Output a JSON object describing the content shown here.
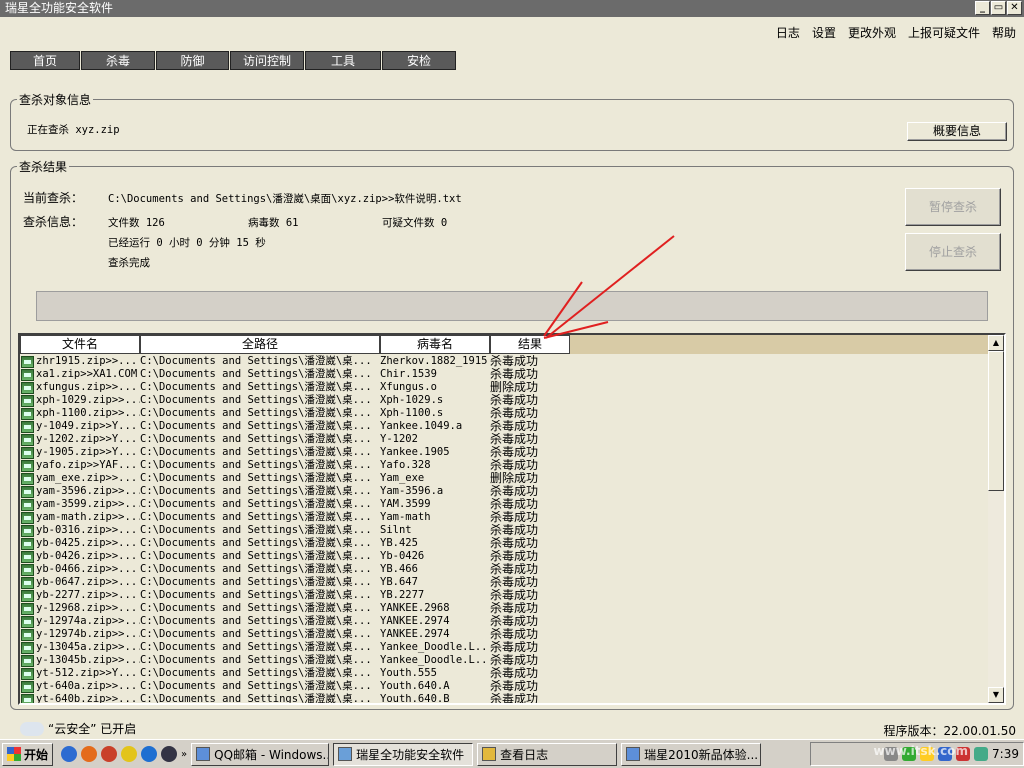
{
  "window": {
    "title": "瑞星全功能安全软件",
    "controls": [
      "_",
      "▭",
      "✕"
    ]
  },
  "top_menu": [
    "日志",
    "设置",
    "更改外观",
    "上报可疑文件",
    "帮助"
  ],
  "tabs": [
    "首页",
    "杀毒",
    "防御",
    "访问控制",
    "工具",
    "安检"
  ],
  "scan_target": {
    "group_title": "查杀对象信息",
    "current_text": "正在查杀 xyz.zip",
    "summary_button": "概要信息"
  },
  "scan_result": {
    "group_title": "查杀结果",
    "current_label": "当前查杀：",
    "current_path": "C:\\Documents and Settings\\潘澄崴\\桌面\\xyz.zip>>软件说明.txt",
    "info_label": "查杀信息：",
    "file_count": "文件数 126",
    "virus_count": "病毒数 61",
    "suspicious_count": "可疑文件数 0",
    "elapsed": "已经运行 0 小时 0 分钟 15  秒",
    "status": "查杀完成",
    "pause_button": "暂停查杀",
    "stop_button": "停止查杀"
  },
  "table": {
    "columns": [
      "文件名",
      "全路径",
      "病毒名",
      "结果"
    ],
    "rows": [
      [
        "zhr1915.zip>>...",
        "C:\\Documents and Settings\\潘澄崴\\桌...",
        "Zherkov.1882_1915",
        "杀毒成功"
      ],
      [
        "xa1.zip>>XA1.COM",
        "C:\\Documents and Settings\\潘澄崴\\桌...",
        "Chir.1539",
        "杀毒成功"
      ],
      [
        "xfungus.zip>>...",
        "C:\\Documents and Settings\\潘澄崴\\桌...",
        "Xfungus.o",
        "删除成功"
      ],
      [
        "xph-1029.zip>>...",
        "C:\\Documents and Settings\\潘澄崴\\桌...",
        "Xph-1029.s",
        "杀毒成功"
      ],
      [
        "xph-1100.zip>>...",
        "C:\\Documents and Settings\\潘澄崴\\桌...",
        "Xph-1100.s",
        "杀毒成功"
      ],
      [
        "y-1049.zip>>Y...",
        "C:\\Documents and Settings\\潘澄崴\\桌...",
        "Yankee.1049.a",
        "杀毒成功"
      ],
      [
        "y-1202.zip>>Y...",
        "C:\\Documents and Settings\\潘澄崴\\桌...",
        "Y-1202",
        "杀毒成功"
      ],
      [
        "y-1905.zip>>Y...",
        "C:\\Documents and Settings\\潘澄崴\\桌...",
        "Yankee.1905",
        "杀毒成功"
      ],
      [
        "yafo.zip>>YAF...",
        "C:\\Documents and Settings\\潘澄崴\\桌...",
        "Yafo.328",
        "杀毒成功"
      ],
      [
        "yam_exe.zip>>...",
        "C:\\Documents and Settings\\潘澄崴\\桌...",
        "Yam_exe",
        "删除成功"
      ],
      [
        "yam-3596.zip>>...",
        "C:\\Documents and Settings\\潘澄崴\\桌...",
        "Yam-3596.a",
        "杀毒成功"
      ],
      [
        "yam-3599.zip>>...",
        "C:\\Documents and Settings\\潘澄崴\\桌...",
        "YAM.3599",
        "杀毒成功"
      ],
      [
        "yam-math.zip>>...",
        "C:\\Documents and Settings\\潘澄崴\\桌...",
        "Yam-math",
        "杀毒成功"
      ],
      [
        "yb-0316.zip>>...",
        "C:\\Documents and Settings\\潘澄崴\\桌...",
        "Silnt",
        "杀毒成功"
      ],
      [
        "yb-0425.zip>>...",
        "C:\\Documents and Settings\\潘澄崴\\桌...",
        "YB.425",
        "杀毒成功"
      ],
      [
        "yb-0426.zip>>...",
        "C:\\Documents and Settings\\潘澄崴\\桌...",
        "Yb-0426",
        "杀毒成功"
      ],
      [
        "yb-0466.zip>>...",
        "C:\\Documents and Settings\\潘澄崴\\桌...",
        "YB.466",
        "杀毒成功"
      ],
      [
        "yb-0647.zip>>...",
        "C:\\Documents and Settings\\潘澄崴\\桌...",
        "YB.647",
        "杀毒成功"
      ],
      [
        "yb-2277.zip>>...",
        "C:\\Documents and Settings\\潘澄崴\\桌...",
        "YB.2277",
        "杀毒成功"
      ],
      [
        "y-12968.zip>>...",
        "C:\\Documents and Settings\\潘澄崴\\桌...",
        "YANKEE.2968",
        "杀毒成功"
      ],
      [
        "y-12974a.zip>>...",
        "C:\\Documents and Settings\\潘澄崴\\桌...",
        "YANKEE.2974",
        "杀毒成功"
      ],
      [
        "y-12974b.zip>>...",
        "C:\\Documents and Settings\\潘澄崴\\桌...",
        "YANKEE.2974",
        "杀毒成功"
      ],
      [
        "y-13045a.zip>>...",
        "C:\\Documents and Settings\\潘澄崴\\桌...",
        "Yankee_Doodle.L...",
        "杀毒成功"
      ],
      [
        "y-13045b.zip>>...",
        "C:\\Documents and Settings\\潘澄崴\\桌...",
        "Yankee_Doodle.L...",
        "杀毒成功"
      ],
      [
        "yt-512.zip>>Y...",
        "C:\\Documents and Settings\\潘澄崴\\桌...",
        "Youth.555",
        "杀毒成功"
      ],
      [
        "yt-640a.zip>>...",
        "C:\\Documents and Settings\\潘澄崴\\桌...",
        "Youth.640.A",
        "杀毒成功"
      ],
      [
        "yt-640b.zip>>...",
        "C:\\Documents and Settings\\潘澄崴\\桌...",
        "Youth.640.B",
        "杀毒成功"
      ]
    ]
  },
  "status_bar": {
    "cloud": "“云安全” 已开启",
    "version": "程序版本：22.00.01.50"
  },
  "taskbar": {
    "start": "开始",
    "tasks": [
      "QQ邮箱 - Windows...",
      "瑞星全功能安全软件",
      "查看日志",
      "瑞星2010新品体验..."
    ],
    "clock": "7:39",
    "watermark": "www.itsk.com"
  },
  "colors": {
    "tab_bg": "#5a5a5a",
    "title_bg": "#6b6b6b",
    "header_tail": "#d8cba6",
    "annotation_arrow": "#e02020"
  }
}
